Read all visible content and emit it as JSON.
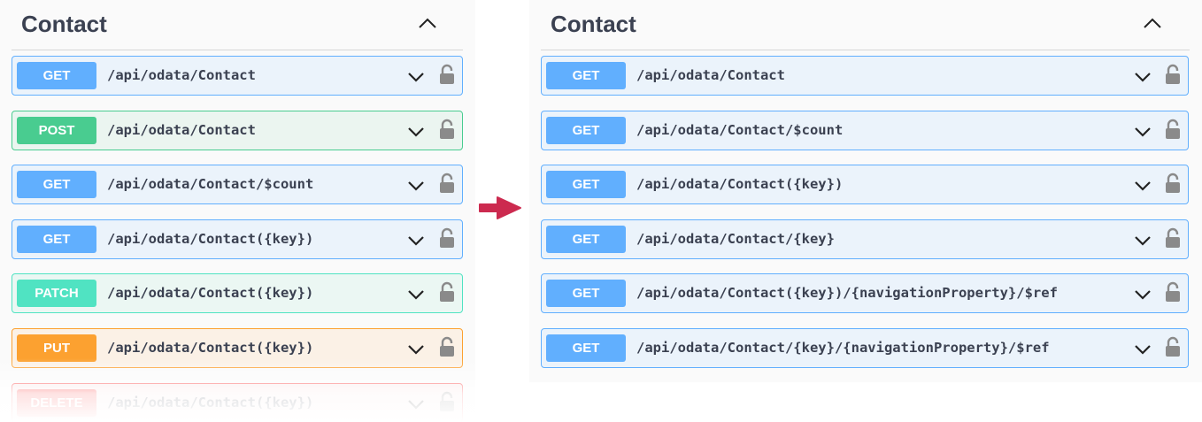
{
  "left_panel": {
    "section_title": "Contact",
    "collapse_icon": "chevron-up-icon",
    "operations": [
      {
        "method": "GET",
        "path": "/api/odata/Contact"
      },
      {
        "method": "POST",
        "path": "/api/odata/Contact"
      },
      {
        "method": "GET",
        "path": "/api/odata/Contact/$count"
      },
      {
        "method": "GET",
        "path": "/api/odata/Contact({key})"
      },
      {
        "method": "PATCH",
        "path": "/api/odata/Contact({key})"
      },
      {
        "method": "PUT",
        "path": "/api/odata/Contact({key})"
      },
      {
        "method": "DELETE",
        "path": "/api/odata/Contact({key})"
      }
    ]
  },
  "transition_arrow": {
    "icon": "arrow-right-icon",
    "color": "#cc2a4f"
  },
  "right_panel": {
    "section_title": "Contact",
    "collapse_icon": "chevron-up-icon",
    "operations": [
      {
        "method": "GET",
        "path": "/api/odata/Contact"
      },
      {
        "method": "GET",
        "path": "/api/odata/Contact/$count"
      },
      {
        "method": "GET",
        "path": "/api/odata/Contact({key})"
      },
      {
        "method": "GET",
        "path": "/api/odata/Contact/{key}"
      },
      {
        "method": "GET",
        "path": "/api/odata/Contact({key})/{navigationProperty}/$ref"
      },
      {
        "method": "GET",
        "path": "/api/odata/Contact/{key}/{navigationProperty}/$ref"
      }
    ]
  },
  "icons": {
    "expand": "chevron-down-icon",
    "auth": "lock-icon"
  },
  "colors": {
    "get": "#61affe",
    "post": "#49cc90",
    "patch": "#50e3c2",
    "put": "#fca130",
    "delete": "#f93e3e",
    "text": "#3b4151"
  }
}
